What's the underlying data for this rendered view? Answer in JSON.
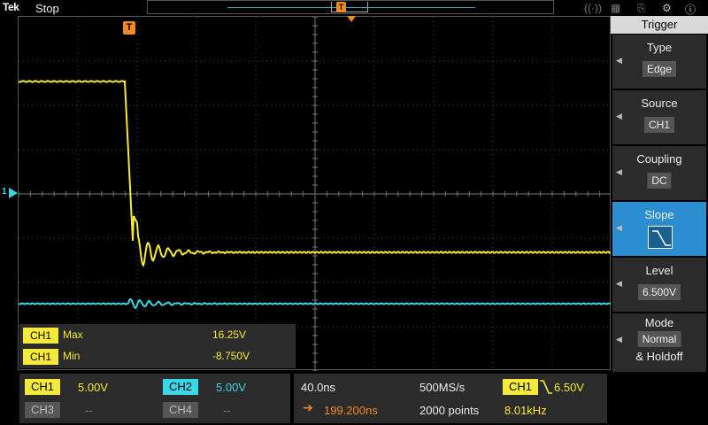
{
  "topbar": {
    "brand": "Tek",
    "run_state": "Stop",
    "trigger_marker": "T"
  },
  "graticule": {
    "trigger_marker": "T",
    "ch1_ground_label": "1"
  },
  "measurements": [
    {
      "channel": "CH1",
      "name": "Max",
      "value": "16.25V"
    },
    {
      "channel": "CH1",
      "name": "Min",
      "value": "-8.750V"
    }
  ],
  "channels": {
    "ch1": {
      "label": "CH1",
      "scale": "5.00V"
    },
    "ch2": {
      "label": "CH2",
      "scale": "5.00V"
    },
    "ch3": {
      "label": "CH3",
      "scale": "--"
    },
    "ch4": {
      "label": "CH4",
      "scale": "--"
    }
  },
  "horizontal": {
    "timebase": "40.0ns",
    "sample_rate": "500MS/s",
    "position": "199.200ns",
    "record_length": "2000 points"
  },
  "trigger_readout": {
    "source": "CH1",
    "level": "6.50V",
    "frequency": "8.01kHz"
  },
  "side_menu": {
    "title": "Trigger",
    "items": [
      {
        "label": "Type",
        "value": "Edge"
      },
      {
        "label": "Source",
        "value": "CH1"
      },
      {
        "label": "Coupling",
        "value": "DC"
      },
      {
        "label": "Slope",
        "value": "falling-edge-icon"
      },
      {
        "label": "Level",
        "value": "6.500V"
      },
      {
        "label": "Mode",
        "value": "Normal",
        "value2": "& Holdoff"
      }
    ]
  },
  "colors": {
    "ch1": "#f5e93a",
    "ch2": "#3ad7e6",
    "trigger": "#f28a1e",
    "active_menu": "#2b8fcf"
  }
}
